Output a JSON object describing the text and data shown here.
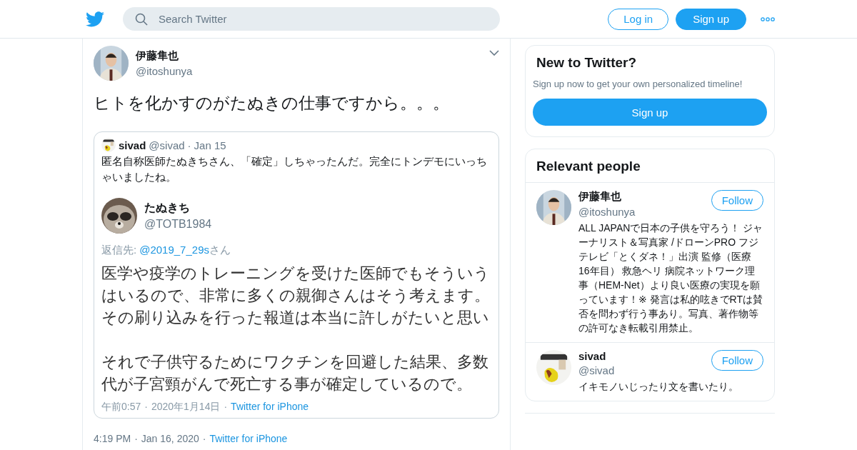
{
  "header": {
    "search_placeholder": "Search Twitter",
    "buttons": [
      {
        "label": "Log in",
        "kind": "outline"
      },
      {
        "label": "Sign up",
        "kind": "filled"
      }
    ]
  },
  "tweet": {
    "name": "伊藤隼也",
    "handle": "@itoshunya",
    "text": "ヒトを化かすのがたぬきの仕事ですから。。。",
    "quote": {
      "name": "sivad",
      "handle": "@sivad",
      "separator": "·",
      "date": "Jan 15",
      "text": "匿名自称医師たぬきちさん、「確定」しちゃったんだ。完全にトンデモにいっちゃいましたね。",
      "screenshot": {
        "name": "たぬきち",
        "handle": "@TOTB1984",
        "reply_prefix": "返信先:",
        "reply_to": "@2019_7_29s",
        "reply_suffix": "さん",
        "paragraphs": [
          [
            "医学や疫学のトレーニングを受けた医師でもそういう",
            "はいるので、非常に多くの親御さんはそう考えます。",
            "その刷り込みを行った報道は本当に許しがたいと思い"
          ],
          [
            "それで子供守るためにワクチンを回避した結果、多数",
            "代が子宮頸がんで死亡する事が確定しているので。"
          ]
        ],
        "time": "午前0:57",
        "separator": "·",
        "date": "2020年1月14日",
        "source": "Twitter for iPhone"
      }
    },
    "time": "4:19 PM",
    "separator": "·",
    "date": "Jan 16, 2020",
    "source": "Twitter for iPhone"
  },
  "signup_card": {
    "title": "New to Twitter?",
    "text": "Sign up now to get your own personalized timeline!",
    "button": "Sign up"
  },
  "relevant_people": {
    "title": "Relevant people",
    "people": [
      {
        "name": "伊藤隼也",
        "handle": "@itoshunya",
        "follow": "Follow",
        "bio": "ALL JAPANで日本の子供を守ろう！ ジャーナリスト＆写真家 /ドローンPRO フジテレビ「とくダネ！」出演 監修（医療 16年目） 救急ヘリ 病院ネットワーク理事（HEM-Net）より良い医療の実現を願っています！※ 発言は私的呟きでRTは賛否を問わず行う事あり。写真、著作物等の許可なき転載引用禁止。"
      },
      {
        "name": "sivad",
        "handle": "@sivad",
        "follow": "Follow",
        "bio": "イキモノいじったり文を書いたり。"
      }
    ]
  }
}
